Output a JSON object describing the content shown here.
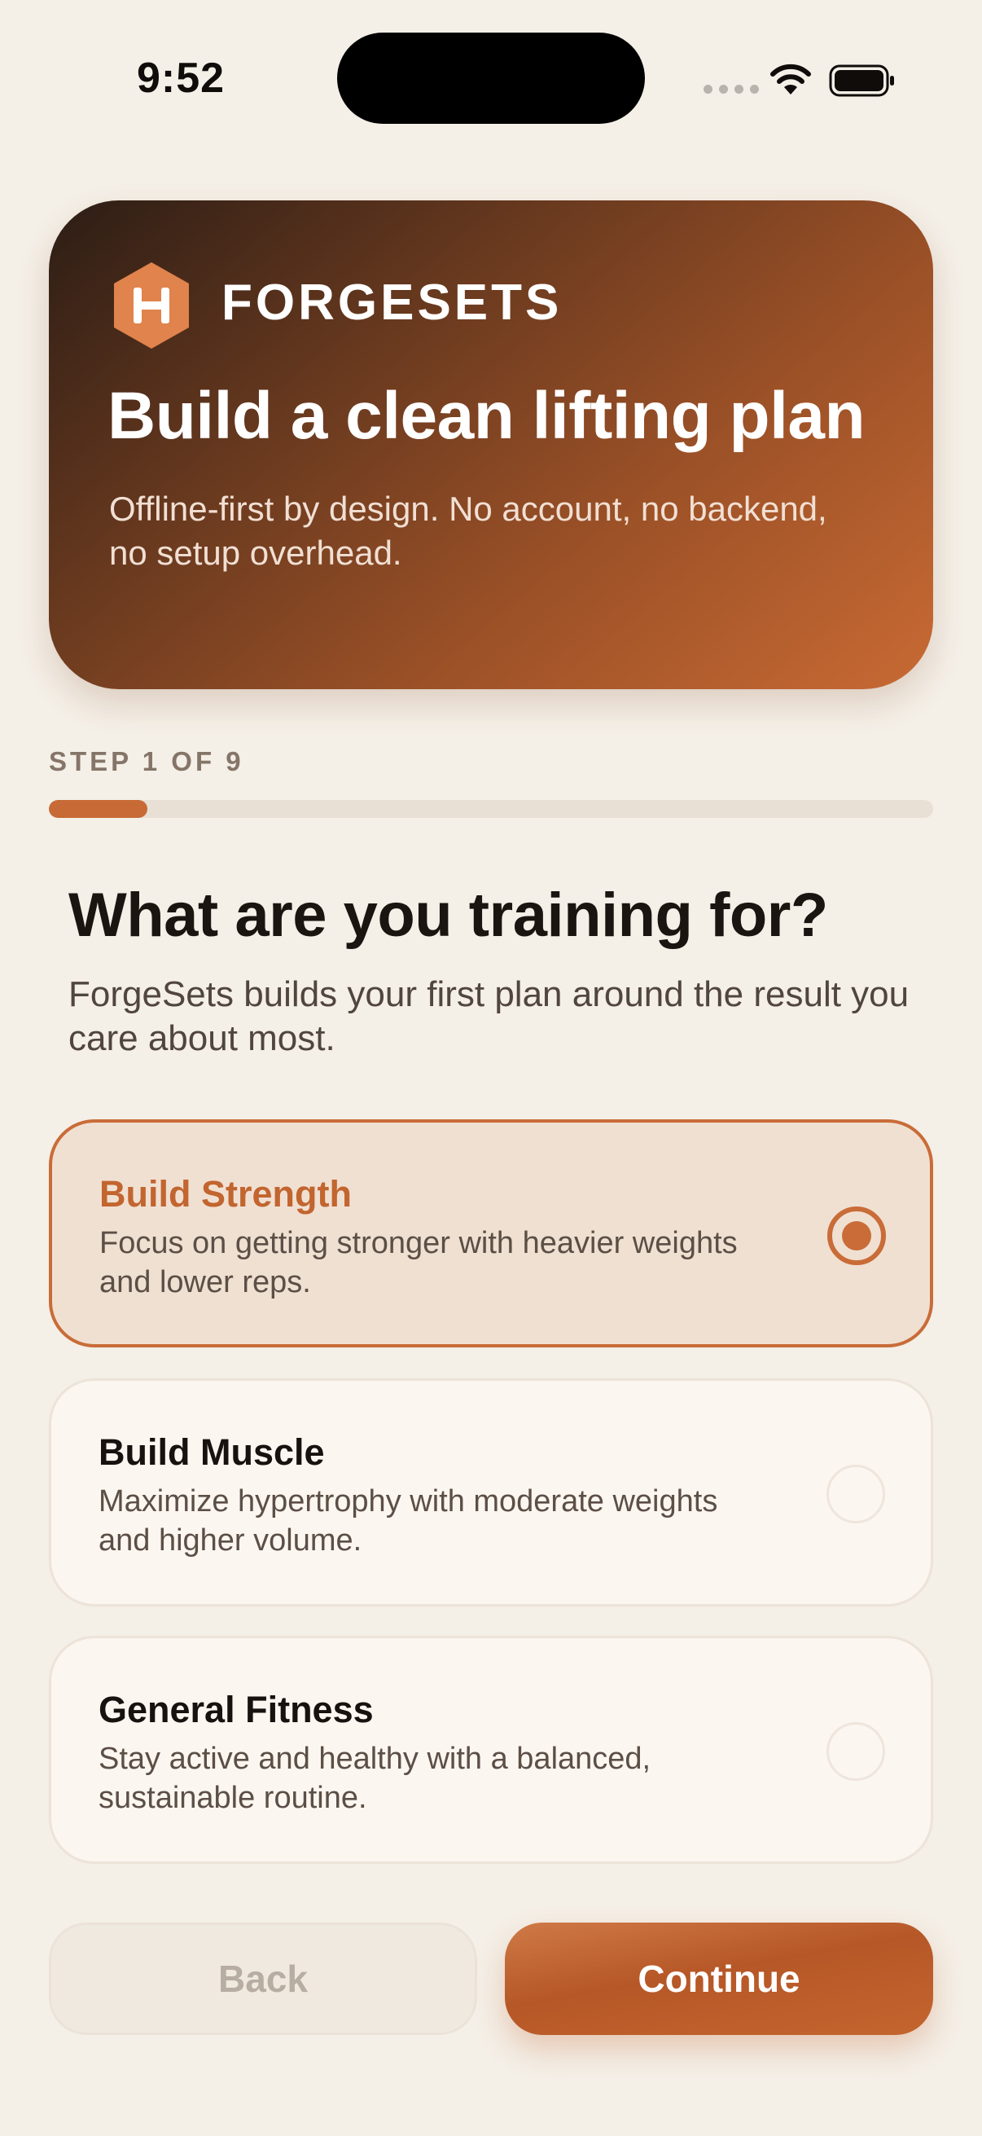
{
  "status_bar": {
    "time": "9:52"
  },
  "hero": {
    "brand_name": "FORGESETS",
    "title": "Build a clean lifting plan",
    "subtitle": "Offline-first by design. No account, no backend, no setup overhead."
  },
  "progress": {
    "label": "STEP 1 OF 9",
    "current_step": 1,
    "total_steps": 9
  },
  "question": {
    "title": "What are you training for?",
    "subtitle": "ForgeSets builds your first plan around the result you care about most."
  },
  "options": [
    {
      "title": "Build Strength",
      "description": "Focus on getting stronger with heavier weights and lower reps.",
      "selected": true
    },
    {
      "title": "Build Muscle",
      "description": "Maximize hypertrophy with moderate weights and higher volume.",
      "selected": false
    },
    {
      "title": "General Fitness",
      "description": "Stay active and healthy with a balanced, sustainable routine.",
      "selected": false
    }
  ],
  "actions": {
    "back_label": "Back",
    "continue_label": "Continue",
    "back_enabled": false
  },
  "colors": {
    "accent": "#c96c38",
    "background": "#f4efe7",
    "card": "#fcf6f0",
    "selected_card": "#f0e0d2"
  }
}
